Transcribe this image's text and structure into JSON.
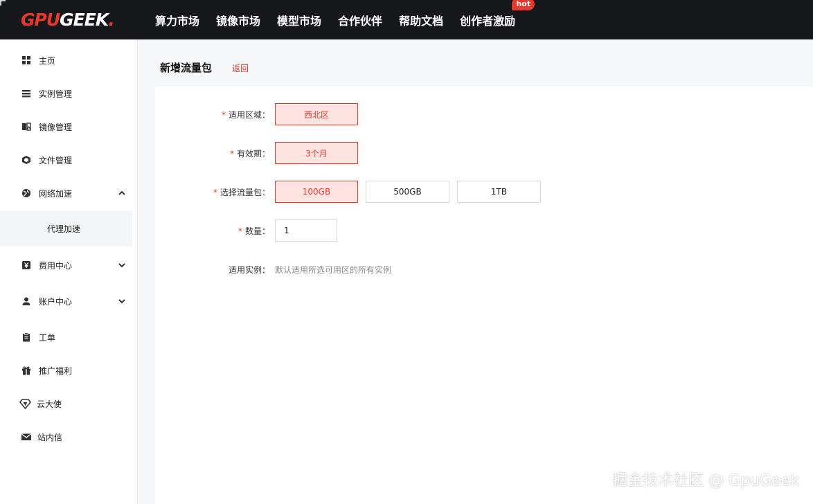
{
  "brand": {
    "part1": "GPU",
    "part2": "GEEK",
    "dot": ".",
    "accent": "#e8382b"
  },
  "nav": {
    "items": [
      "算力市场",
      "镜像市场",
      "模型市场",
      "合作伙伴",
      "帮助文档",
      "创作者激励"
    ],
    "hot_badge": "hot"
  },
  "sidebar": {
    "items": [
      {
        "label": "主页",
        "icon": "grid-icon"
      },
      {
        "label": "实例管理",
        "icon": "list-icon"
      },
      {
        "label": "镜像管理",
        "icon": "image-icon"
      },
      {
        "label": "文件管理",
        "icon": "cube-icon"
      },
      {
        "label": "网络加速",
        "icon": "globe-icon",
        "expanded": true
      },
      {
        "label": "费用中心",
        "icon": "yen-icon",
        "expanded": false
      },
      {
        "label": "账户中心",
        "icon": "user-icon",
        "expanded": false
      },
      {
        "label": "工单",
        "icon": "clipboard-icon"
      },
      {
        "label": "推广福利",
        "icon": "gift-icon"
      },
      {
        "label": "云大使",
        "icon": "diamond-icon"
      },
      {
        "label": "站内信",
        "icon": "mail-icon"
      }
    ],
    "sub_item": "代理加速"
  },
  "page": {
    "title": "新增流量包",
    "back": "返回"
  },
  "form": {
    "required_mark": "*",
    "region": {
      "label": "适用区域：",
      "options": [
        "西北区"
      ],
      "selected": "西北区"
    },
    "validity": {
      "label": "有效期：",
      "options": [
        "3个月"
      ],
      "selected": "3个月"
    },
    "package": {
      "label": "选择流量包：",
      "options": [
        "100GB",
        "500GB",
        "1TB"
      ],
      "selected": "100GB"
    },
    "quantity": {
      "label": "数量：",
      "value": "1"
    },
    "instances": {
      "label": "适用实例：",
      "hint": "默认适用所选可用区的所有实例"
    }
  },
  "watermark": "掘金技术社区 @ GpuGeek"
}
